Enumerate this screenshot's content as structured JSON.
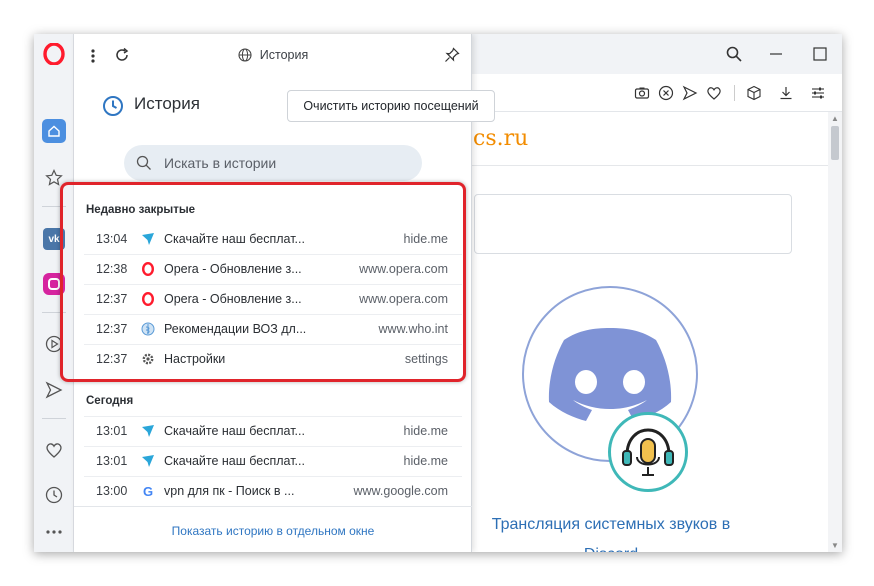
{
  "panel": {
    "top_title": "История",
    "heading": "История",
    "clear_button": "Очистить историю посещений",
    "search_placeholder": "Искать в истории",
    "show_link": "Показать историю в отдельном окне"
  },
  "recently_closed": {
    "title": "Недавно закрытые",
    "rows": [
      {
        "time": "13:04",
        "title": "Скачайте наш бесплат...",
        "domain": "hide.me",
        "icon": "hideme-icon"
      },
      {
        "time": "12:38",
        "title": "Opera - Обновление з...",
        "domain": "www.opera.com",
        "icon": "opera-icon"
      },
      {
        "time": "12:37",
        "title": "Opera - Обновление з...",
        "domain": "www.opera.com",
        "icon": "opera-icon"
      },
      {
        "time": "12:37",
        "title": "Рекомендации ВОЗ дл...",
        "domain": "www.who.int",
        "icon": "who-icon"
      },
      {
        "time": "12:37",
        "title": "Настройки",
        "domain": "settings",
        "icon": "gear-icon"
      }
    ]
  },
  "today": {
    "title": "Сегодня",
    "rows": [
      {
        "time": "13:01",
        "title": "Скачайте наш бесплат...",
        "domain": "hide.me",
        "icon": "hideme-icon"
      },
      {
        "time": "13:01",
        "title": "Скачайте наш бесплат...",
        "domain": "hide.me",
        "icon": "hideme-icon"
      },
      {
        "time": "13:00",
        "title": "vpn для пк - Поиск в ...",
        "domain": "www.google.com",
        "icon": "google-icon"
      }
    ]
  },
  "page": {
    "site_logo_text": "cs.ru",
    "article_title": "Трансляция системных звуков в Discord"
  },
  "colors": {
    "accent": "#2f76c2",
    "highlight": "#e0242b",
    "opera_red": "#ff1b2d",
    "logo_orange": "#f28c00"
  }
}
